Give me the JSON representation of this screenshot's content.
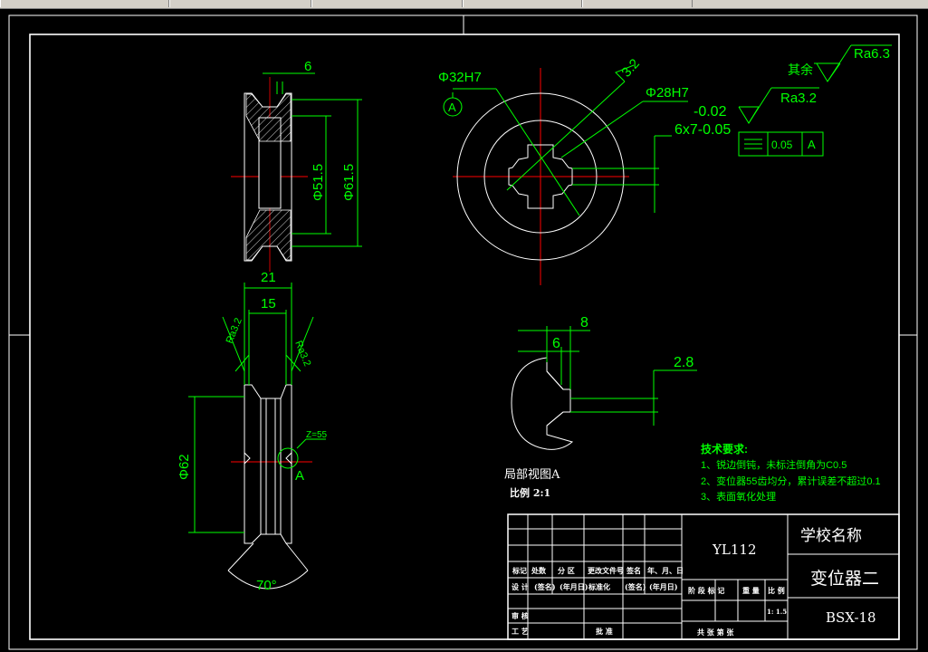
{
  "dims": {
    "width_6": "6",
    "dia_51_5": "Φ51.5",
    "dia_61_5": "Φ61.5",
    "width_21": "21",
    "width_15": "15",
    "dia_62": "Φ62",
    "angle_70": "70°",
    "z55": "Z=55",
    "detail_mark": "A",
    "dia_32h7": "Φ32H7",
    "datum_a": "A",
    "ra_32_angled": "3.2",
    "dia_28h7": "Φ28H7",
    "tol_minus": "-0.02",
    "spline": "6x7-0.05",
    "gtol_value": "0.05",
    "gtol_datum": "A",
    "ra_left": "Ra3.2",
    "ra_right": "Ra3.2",
    "detail_8": "8",
    "detail_6": "6",
    "detail_2_8": "2.8"
  },
  "roughness": {
    "other_label": "其余",
    "ra_63": "Ra6.3",
    "ra_32": "Ra3.2"
  },
  "detail_view": {
    "title": "局部视图A",
    "scale": "比例  2:1"
  },
  "notes": {
    "title": "技术要求:",
    "items": [
      "1、锐边倒钝，未标注倒角为C0.5",
      "2、变位器55齿均分，累计误差不超过0.1",
      "3、表面氧化处理"
    ]
  },
  "title_block": {
    "drawing_code": "YL112",
    "school": "学校名称",
    "part_name": "变位器二",
    "number": "BSX-18",
    "hdr_mark": "标记",
    "hdr_count": "处数",
    "hdr_zone": "分 区",
    "hdr_doc": "更改文件号",
    "hdr_sign": "签名",
    "hdr_date": "年、月、日",
    "design": "设 计",
    "sign_paren": "(签名)",
    "date_paren": "(年月日)",
    "standard": "标准化",
    "stage_mark": "阶 段 标 记",
    "weight": "重 量",
    "scale": "比 例",
    "scale_val": "1: 1.5",
    "review": "审 核",
    "process": "工 艺",
    "approve": "批 准",
    "sheets": "共   张   第   张"
  }
}
